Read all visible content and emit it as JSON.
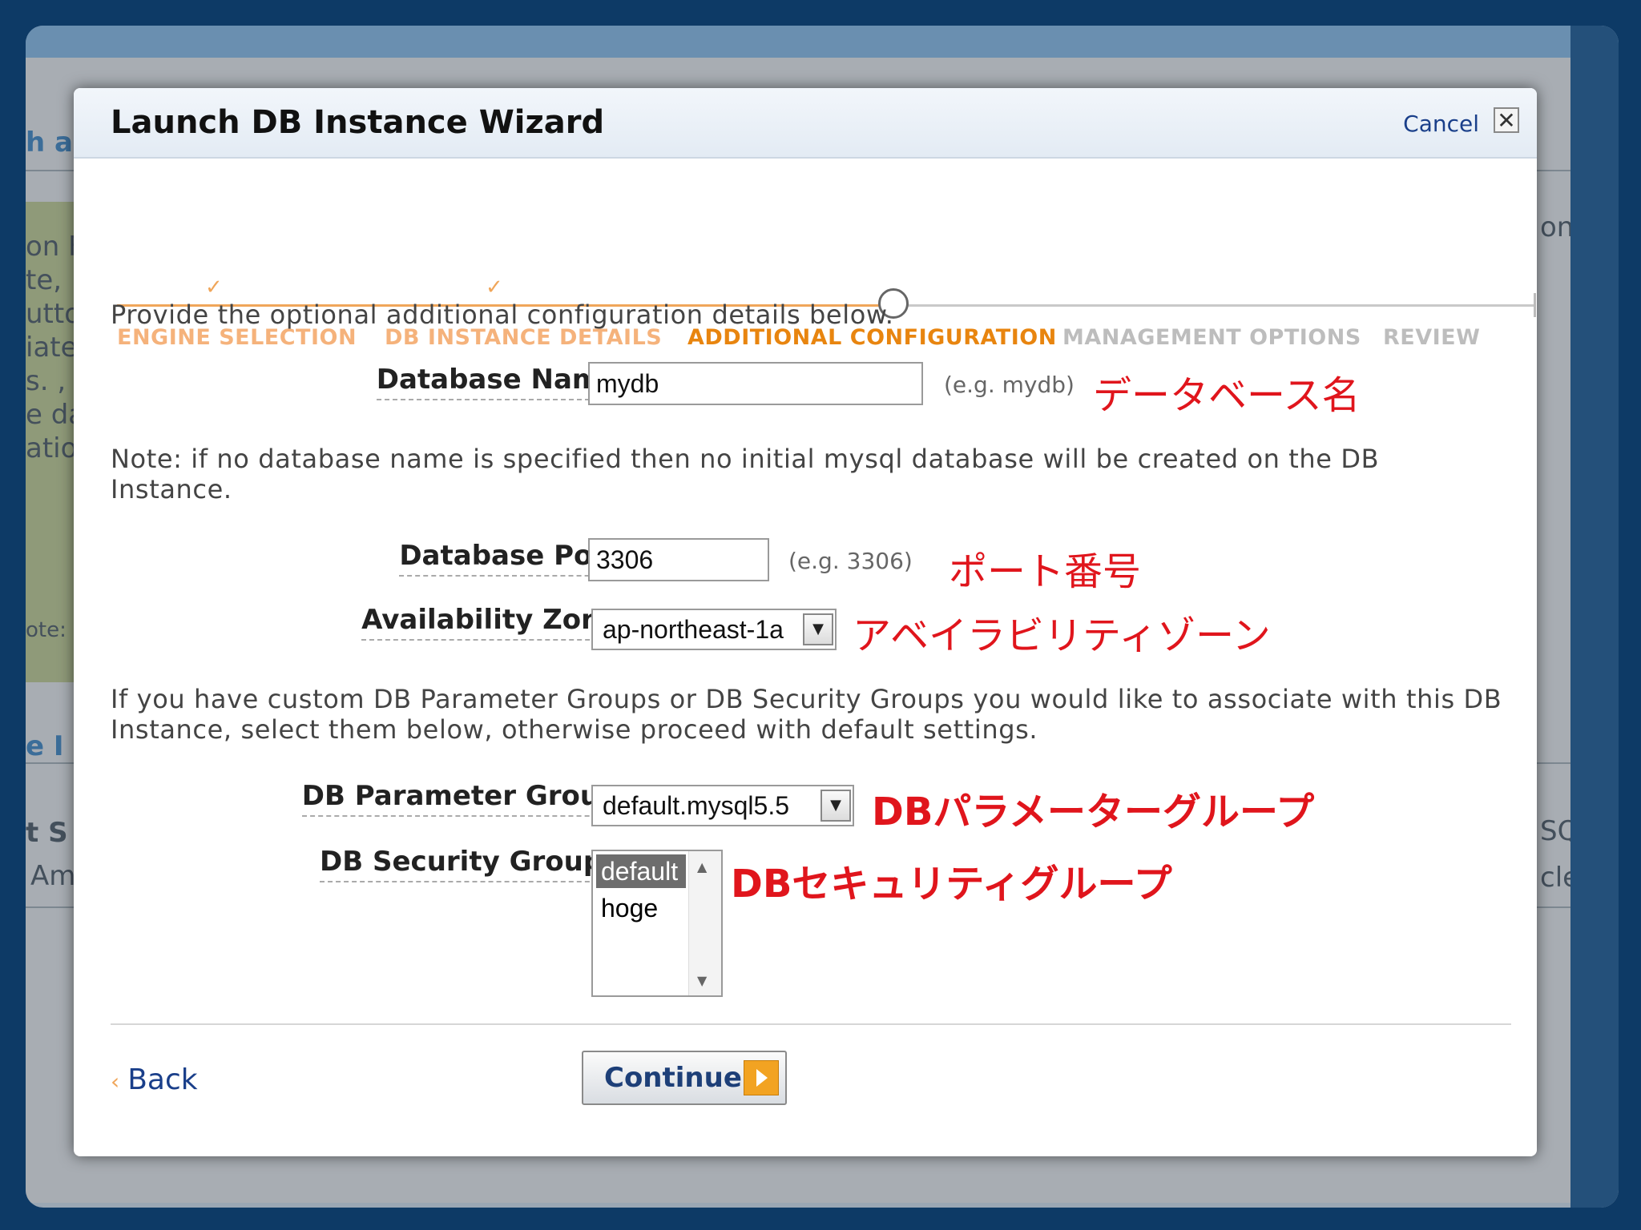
{
  "dialog": {
    "title": "Launch DB Instance Wizard",
    "cancel_label": "Cancel",
    "close_glyph": "✕"
  },
  "steps": [
    {
      "label": "ENGINE SELECTION",
      "state": "done"
    },
    {
      "label": "DB INSTANCE DETAILS",
      "state": "done"
    },
    {
      "label": "ADDITIONAL CONFIGURATION",
      "state": "current"
    },
    {
      "label": "MANAGEMENT OPTIONS",
      "state": "future"
    },
    {
      "label": "REVIEW",
      "state": "future"
    }
  ],
  "intro": "Provide the optional additional configuration details below.",
  "database_name": {
    "label": "Database Name:",
    "value": "mydb",
    "hint": "(e.g. mydb)",
    "annotation": "データベース名"
  },
  "note": "Note: if no database name is specified then no initial mysql database will be created on the DB Instance.",
  "database_port": {
    "label": "Database Port:",
    "value": "3306",
    "hint": "(e.g. 3306)",
    "annotation": "ポート番号"
  },
  "availability_zone": {
    "label": "Availability Zone:",
    "value": "ap-northeast-1a",
    "annotation": "アベイラビリティゾーン"
  },
  "groups_intro": "If you have custom DB Parameter Groups or DB Security Groups you would like to associate with this DB Instance, select them below, otherwise proceed with default settings.",
  "parameter_group": {
    "label": "DB Parameter Group:",
    "value": "default.mysql5.5",
    "annotation": "DBパラメーターグループ"
  },
  "security_groups": {
    "label": "DB Security Groups:",
    "options": [
      "default",
      "hoge"
    ],
    "selected": "default",
    "annotation": "DBセキュリティグループ"
  },
  "footer": {
    "back_label": "Back",
    "continue_label": "Continue"
  },
  "background_fragments": [
    "h a",
    "on F",
    "te,",
    "utto",
    "iate",
    "s. ,",
    "e da",
    "atio",
    "ote:",
    "e I",
    "t S",
    "Am",
    "on",
    "SQ",
    "cle"
  ]
}
